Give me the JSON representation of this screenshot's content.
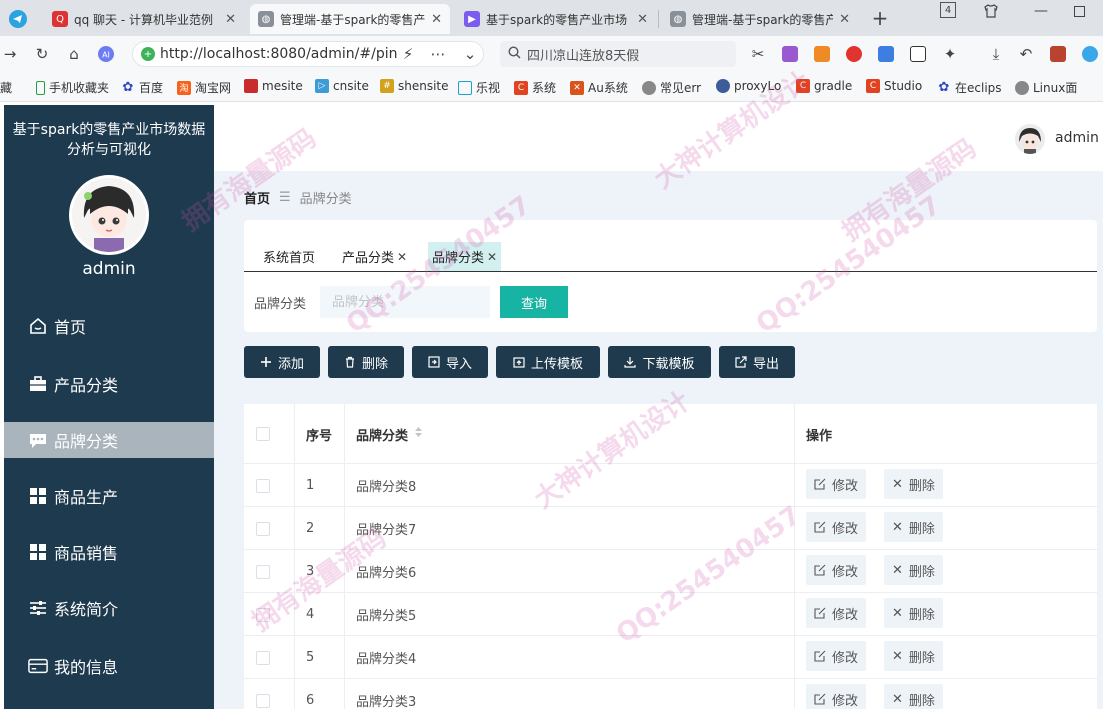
{
  "browser": {
    "tabs": [
      {
        "title": "qq 聊天 - 计算机毕业范例",
        "icon": "qq-app-icon"
      },
      {
        "title": "管理端-基于spark的零售产",
        "icon": "globe-icon",
        "active": true
      },
      {
        "title": "基于spark的零售产业市场",
        "icon": "video-icon"
      },
      {
        "title": "管理端-基于spark的零售产",
        "icon": "globe-icon"
      }
    ],
    "tab_count": "4",
    "url": "http://localhost:8080/admin/#/pin",
    "search_text": "四川凉山连放8天假",
    "bookmarks": [
      "藏",
      "手机收藏夹",
      "百度",
      "淘宝网",
      "mesite",
      "cnsite",
      "shensite",
      "乐视",
      "系统",
      "Au系统",
      "常见err",
      "proxyLo",
      "gradle",
      "Studio",
      "在eclips",
      "Linux面"
    ]
  },
  "sidebar": {
    "title": "基于spark的零售产业市场数据分析与可视化",
    "username": "admin",
    "items": [
      {
        "label": "首页",
        "icon": "home-icon"
      },
      {
        "label": "产品分类",
        "icon": "briefcase-icon"
      },
      {
        "label": "品牌分类",
        "icon": "chat-icon",
        "active": true
      },
      {
        "label": "商品生产",
        "icon": "grid-icon"
      },
      {
        "label": "商品销售",
        "icon": "grid-icon"
      },
      {
        "label": "系统简介",
        "icon": "sliders-icon"
      },
      {
        "label": "我的信息",
        "icon": "card-icon"
      }
    ]
  },
  "header": {
    "username": "admin"
  },
  "breadcrumb": {
    "home": "首页",
    "current": "品牌分类"
  },
  "view_tabs": [
    {
      "label": "系统首页"
    },
    {
      "label": "产品分类",
      "closable": true
    },
    {
      "label": "品牌分类",
      "closable": true,
      "active": true
    }
  ],
  "search": {
    "label": "品牌分类",
    "placeholder": "品牌分类",
    "button": "查询"
  },
  "actions": [
    "添加",
    "删除",
    "导入",
    "上传模板",
    "下载模板",
    "导出"
  ],
  "table": {
    "columns": [
      "序号",
      "品牌分类",
      "操作"
    ],
    "rows": [
      {
        "index": "1",
        "name": "品牌分类8"
      },
      {
        "index": "2",
        "name": "品牌分类7"
      },
      {
        "index": "3",
        "name": "品牌分类6"
      },
      {
        "index": "4",
        "name": "品牌分类5"
      },
      {
        "index": "5",
        "name": "品牌分类4"
      },
      {
        "index": "6",
        "name": "品牌分类3"
      }
    ],
    "edit_label": "修改",
    "delete_label": "删除"
  },
  "watermarks": [
    "拥有海量源码",
    "QQ:254540457",
    "大神计算机设计"
  ],
  "colors": {
    "sidebar": "#1e3a4f",
    "accent": "#17b3a3",
    "active_menu": "#a9b4bc",
    "action_button": "#1f3a4d"
  }
}
